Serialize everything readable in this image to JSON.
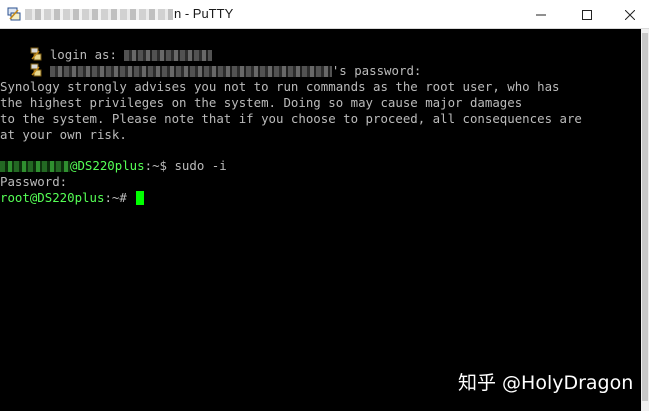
{
  "window": {
    "title_suffix": "n - PuTTY",
    "icon": "putty-icon"
  },
  "controls": {
    "minimize": "minimize-icon",
    "maximize": "maximize-icon",
    "close": "close-icon"
  },
  "terminal": {
    "login_prompt": "login as:",
    "password_prompt_suffix": "'s password:",
    "warning_lines": [
      "Synology strongly advises you not to run commands as the root user, who has",
      "the highest privileges on the system. Doing so may cause major damages",
      "to the system. Please note that if you choose to proceed, all consequences are",
      "at your own risk."
    ],
    "user_host_suffix": "@DS220plus",
    "prompt1_tail": ":~$ sudo -i",
    "password_label": "Password:",
    "root_host": "root@DS220plus",
    "prompt2_tail": ":~#"
  },
  "watermark": "知乎 @HolyDragon",
  "colors": {
    "background": "#000000",
    "text": "#bbbbbb",
    "prompt_green": "#55ff55",
    "cursor": "#00ff00"
  }
}
